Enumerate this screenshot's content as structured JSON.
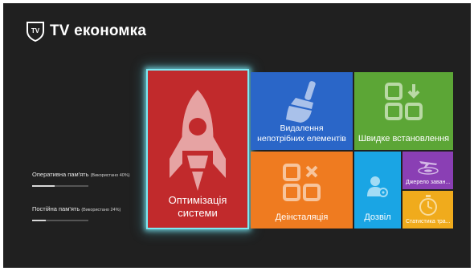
{
  "app": {
    "title": "TV економка",
    "logo_icon": "tv-shield-icon"
  },
  "memory": {
    "ram": {
      "label": "Оперативна пам'ять",
      "detail": "(Використано 40%)",
      "used_fraction": 0.4
    },
    "rom": {
      "label": "Постійна пам'ять",
      "detail": "(Використано 24%)",
      "used_fraction": 0.24
    }
  },
  "tiles": {
    "optimize": {
      "label_line1": "Оптимізація",
      "label_line2": "системи",
      "icon": "rocket-icon",
      "color": "#c12a2c",
      "focused": true
    },
    "delete_junk": {
      "label_line1": "Видалення",
      "label_line2": "непотрібних елементів",
      "icon": "broom-icon",
      "color": "#2a66c8"
    },
    "quick_install": {
      "label": "Швидке встановлення",
      "icon": "install-grid-icon",
      "color": "#5ca636"
    },
    "uninstall": {
      "label": "Деінсталяція",
      "icon": "remove-grid-icon",
      "color": "#ef7b20"
    },
    "permission": {
      "label": "Дозвіл",
      "icon": "user-gear-icon",
      "color": "#1aa5e4"
    },
    "download_source": {
      "label": "Джерело заван...",
      "icon": "airplane-target-icon",
      "color": "#8a3fb4"
    },
    "traffic_stats": {
      "label": "Статистика тра...",
      "icon": "stopwatch-icon",
      "color": "#f0ab1c"
    }
  },
  "colors": {
    "background": "#202020",
    "focus_glow": "#7ce9f2"
  }
}
